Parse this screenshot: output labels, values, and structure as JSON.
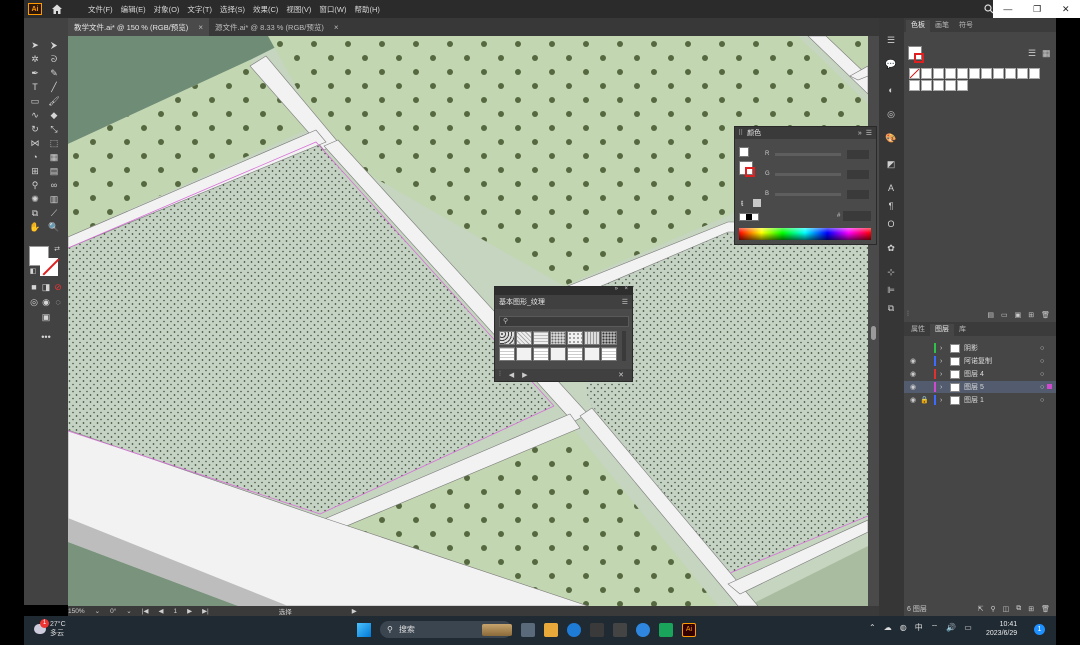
{
  "menubar": {
    "app_badge": "Ai",
    "items": [
      "文件(F)",
      "编辑(E)",
      "对象(O)",
      "文字(T)",
      "选择(S)",
      "效果(C)",
      "视图(V)",
      "窗口(W)",
      "帮助(H)"
    ]
  },
  "tabs": [
    {
      "label": "教学文件.ai* @ 150 % (RGB/预览)",
      "close": "×",
      "active": true
    },
    {
      "label": "源文件.ai* @ 8.33 % (RGB/预览)",
      "close": "×",
      "active": false
    }
  ],
  "statusbar": {
    "zoom": "150%",
    "angle": "0°",
    "artboard": "1",
    "tool": "选择"
  },
  "swatches_panel": {
    "tabs": [
      "色板",
      "画笔",
      "符号"
    ]
  },
  "color_panel": {
    "title": "颜色",
    "channels": [
      "R",
      "G",
      "B"
    ],
    "hex_label": "#"
  },
  "pattern_panel": {
    "title": "基本图形_纹理"
  },
  "layers_panel": {
    "tabs": [
      "属性",
      "图层",
      "库"
    ],
    "layers": [
      {
        "name": "阴影",
        "color": "#2ec24a",
        "visible": false,
        "locked": false,
        "selected": false
      },
      {
        "name": "阿诺复制",
        "color": "#3d6bff",
        "visible": true,
        "locked": false,
        "selected": false
      },
      {
        "name": "图层 4",
        "color": "#e03030",
        "visible": true,
        "locked": false,
        "selected": false
      },
      {
        "name": "图层 5",
        "color": "#d04ad0",
        "visible": true,
        "locked": false,
        "selected": true
      },
      {
        "name": "图层 1",
        "color": "#3d6bff",
        "visible": true,
        "locked": true,
        "selected": false
      }
    ],
    "count_label": "6 图层"
  },
  "taskbar": {
    "weather_temp": "27°C",
    "weather_desc": "多云",
    "weather_badge": "1",
    "search_label": "搜索",
    "ime": "中",
    "time": "10:41",
    "date": "2023/6/29",
    "notifications": "1"
  },
  "colors": {
    "canvas_green": "#c5d5c0",
    "field_green": "#c2d6b1",
    "road": "#f2f2f2",
    "dot": "#56683f",
    "accent_selected": "#535c6e"
  }
}
